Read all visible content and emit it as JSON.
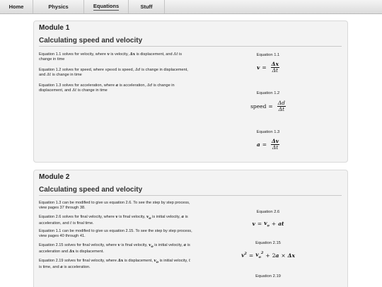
{
  "nav": {
    "items": [
      {
        "label": "Home"
      },
      {
        "label": "Physics"
      },
      {
        "label": "Equations"
      },
      {
        "label": "Stuff"
      }
    ]
  },
  "module1": {
    "title": "Module 1",
    "subtitle": "Calculating speed and velocity",
    "descriptions": [
      {
        "p1": "Equation 1.1 solves for velocity, where ",
        "p2": " is velocity, ",
        "p3": " is displacement, and ",
        "p4": " is change in time"
      },
      {
        "p1": "Equation 1.2 solves for speed, where ",
        "p2": " is speed, ",
        "p3": " is change in displacement, and ",
        "p4": " is change in time"
      },
      {
        "p1": "Equation 1.3 solves for acceleration, where ",
        "p2": " is acceleration, ",
        "p3": " is change in displacement, and ",
        "p4": " is change in time"
      }
    ],
    "equations": [
      {
        "label": "Equation 1.1"
      },
      {
        "label": "Equation 1.2"
      },
      {
        "label": "Equation 1.3"
      }
    ]
  },
  "module2": {
    "title": "Module 2",
    "subtitle": "Calculating speed and velocity",
    "descriptions": [
      {
        "text": "Equation 1.3 can be modified to give us equation 2.6. To see the step by step process, view pages 37 through 38."
      },
      {
        "p1": "Equation 2.6 solves for final velocity, where ",
        "p2": " is final velocity, ",
        "p3": " is initial velocity, ",
        "p4": " is acceleration, and ",
        "p5": " is final time."
      },
      {
        "text": "Equation 1.1 can be modified to give us equation 2.15. To see the step by step process, view pages 40 through 41."
      },
      {
        "p1": "Equation 2.15 solves for final velocity, where ",
        "p2": " is final velocity, ",
        "p3": " is initial velocity, ",
        "p4": " is acceleration and ",
        "p5": " is displacement."
      },
      {
        "p1": "Equation 2.19 solves for final velocity, where ",
        "p2": " is displacement, ",
        "p3": " is initial velocity, ",
        "p4": " is time, and ",
        "p5": " is acceleration."
      }
    ],
    "equations": [
      {
        "label": "Equation 2.6"
      },
      {
        "label": "Equation 2.15"
      },
      {
        "label": "Equation 2.19"
      }
    ]
  }
}
